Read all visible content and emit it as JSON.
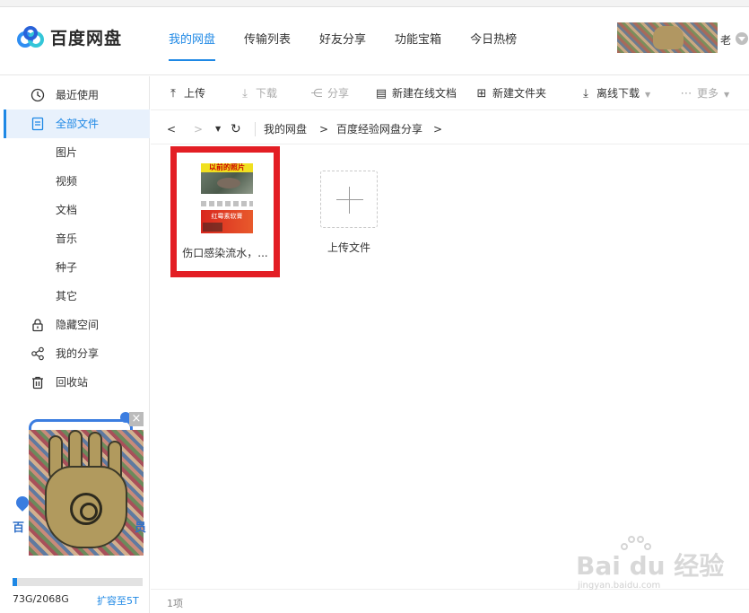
{
  "app": {
    "logo_text": "百度网盘",
    "accent_color": "#1e88e5",
    "highlight_color": "#e31e24"
  },
  "nav": {
    "tabs": [
      {
        "label": "我的网盘",
        "active": true
      },
      {
        "label": "传输列表"
      },
      {
        "label": "好友分享"
      },
      {
        "label": "功能宝箱"
      },
      {
        "label": "今日热榜"
      }
    ]
  },
  "user": {
    "name_visible": "老"
  },
  "sidebar": {
    "items": [
      {
        "label": "最近使用",
        "icon": "clock-icon"
      },
      {
        "label": "全部文件",
        "icon": "document-icon",
        "active": true
      },
      {
        "label": "图片"
      },
      {
        "label": "视频"
      },
      {
        "label": "文档"
      },
      {
        "label": "音乐"
      },
      {
        "label": "种子"
      },
      {
        "label": "其它"
      },
      {
        "label": "隐藏空间",
        "icon": "lock-icon"
      },
      {
        "label": "我的分享",
        "icon": "share-icon"
      },
      {
        "label": "回收站",
        "icon": "trash-icon"
      }
    ],
    "ad": {
      "close": "×",
      "left_text": "百",
      "right_text": "员"
    },
    "quota": {
      "used_fraction": 0.035,
      "text": "73G/2068G",
      "expand_label": "扩容至5T"
    }
  },
  "toolbar": {
    "upload": "上传",
    "download": "下载",
    "share": "分享",
    "new_online_doc": "新建在线文档",
    "new_folder": "新建文件夹",
    "offline_download": "离线下载",
    "more": "更多"
  },
  "pathbar": {
    "back": "<",
    "forward": ">",
    "refresh": "↻",
    "crumbs": [
      "我的网盘",
      "百度经验网盘分享"
    ],
    "separator": ">"
  },
  "files": [
    {
      "name": "伤口感染流水，...",
      "thumb_title": "以前的照片",
      "thumb_banner": "红霉素软膏"
    }
  ],
  "upload_tile": {
    "label": "上传文件"
  },
  "status": {
    "count": "1项"
  },
  "watermark": {
    "main": "Bai du 经验",
    "sub": "jingyan.baidu.com"
  }
}
